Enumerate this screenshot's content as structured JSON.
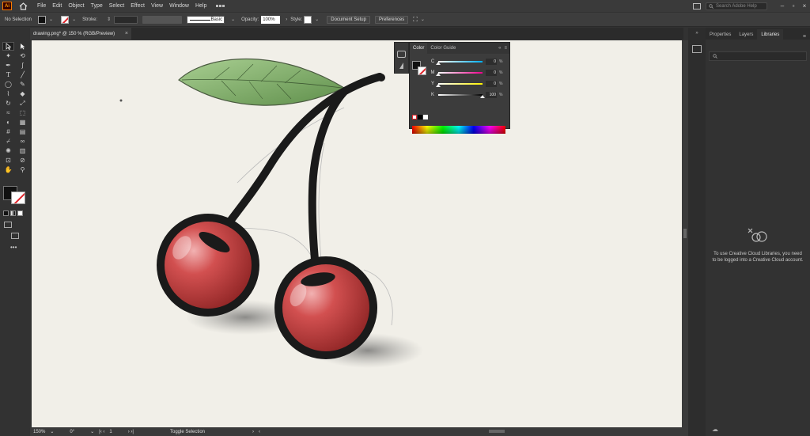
{
  "app": {
    "logo_text": "Ai"
  },
  "menu": [
    "File",
    "Edit",
    "Object",
    "Type",
    "Select",
    "Effect",
    "View",
    "Window",
    "Help"
  ],
  "search": {
    "placeholder": "Search Adobe Help"
  },
  "control_bar": {
    "selection_label": "No Selection",
    "stroke_label": "Stroke:",
    "brush_label": "Basic",
    "opacity_label": "Opacity:",
    "opacity_value": "100%",
    "style_label": "Style:",
    "doc_setup": "Document Setup",
    "preferences": "Preferences"
  },
  "document": {
    "tab_title": "drawing.png* @ 150 % (RGB/Preview)",
    "close": "×"
  },
  "status": {
    "zoom": "150%",
    "rotation": "0°",
    "page": "1",
    "tool_label": "Toggle Selection"
  },
  "color_panel": {
    "tabs": [
      "Color",
      "Color Guide"
    ],
    "sliders": [
      {
        "label": "C",
        "value": "0",
        "unit": "%",
        "level": 0.0
      },
      {
        "label": "M",
        "value": "0",
        "unit": "%",
        "level": 0.0
      },
      {
        "label": "Y",
        "value": "0",
        "unit": "%",
        "level": 0.0
      },
      {
        "label": "K",
        "value": "100",
        "unit": "%",
        "level": 1.0
      }
    ]
  },
  "right_panel": {
    "tabs": [
      "Properties",
      "Layers",
      "Libraries"
    ],
    "active_tab": "Libraries",
    "message": "To use Creative Cloud Libraries, you need to be logged into a Creative Cloud account."
  },
  "colors": {
    "accent": "#ff7c00",
    "stroke_none": "#e0242b",
    "canvas": "#f1efe8",
    "cherry": "#c43a3a",
    "leaf": "#7fae6a"
  }
}
